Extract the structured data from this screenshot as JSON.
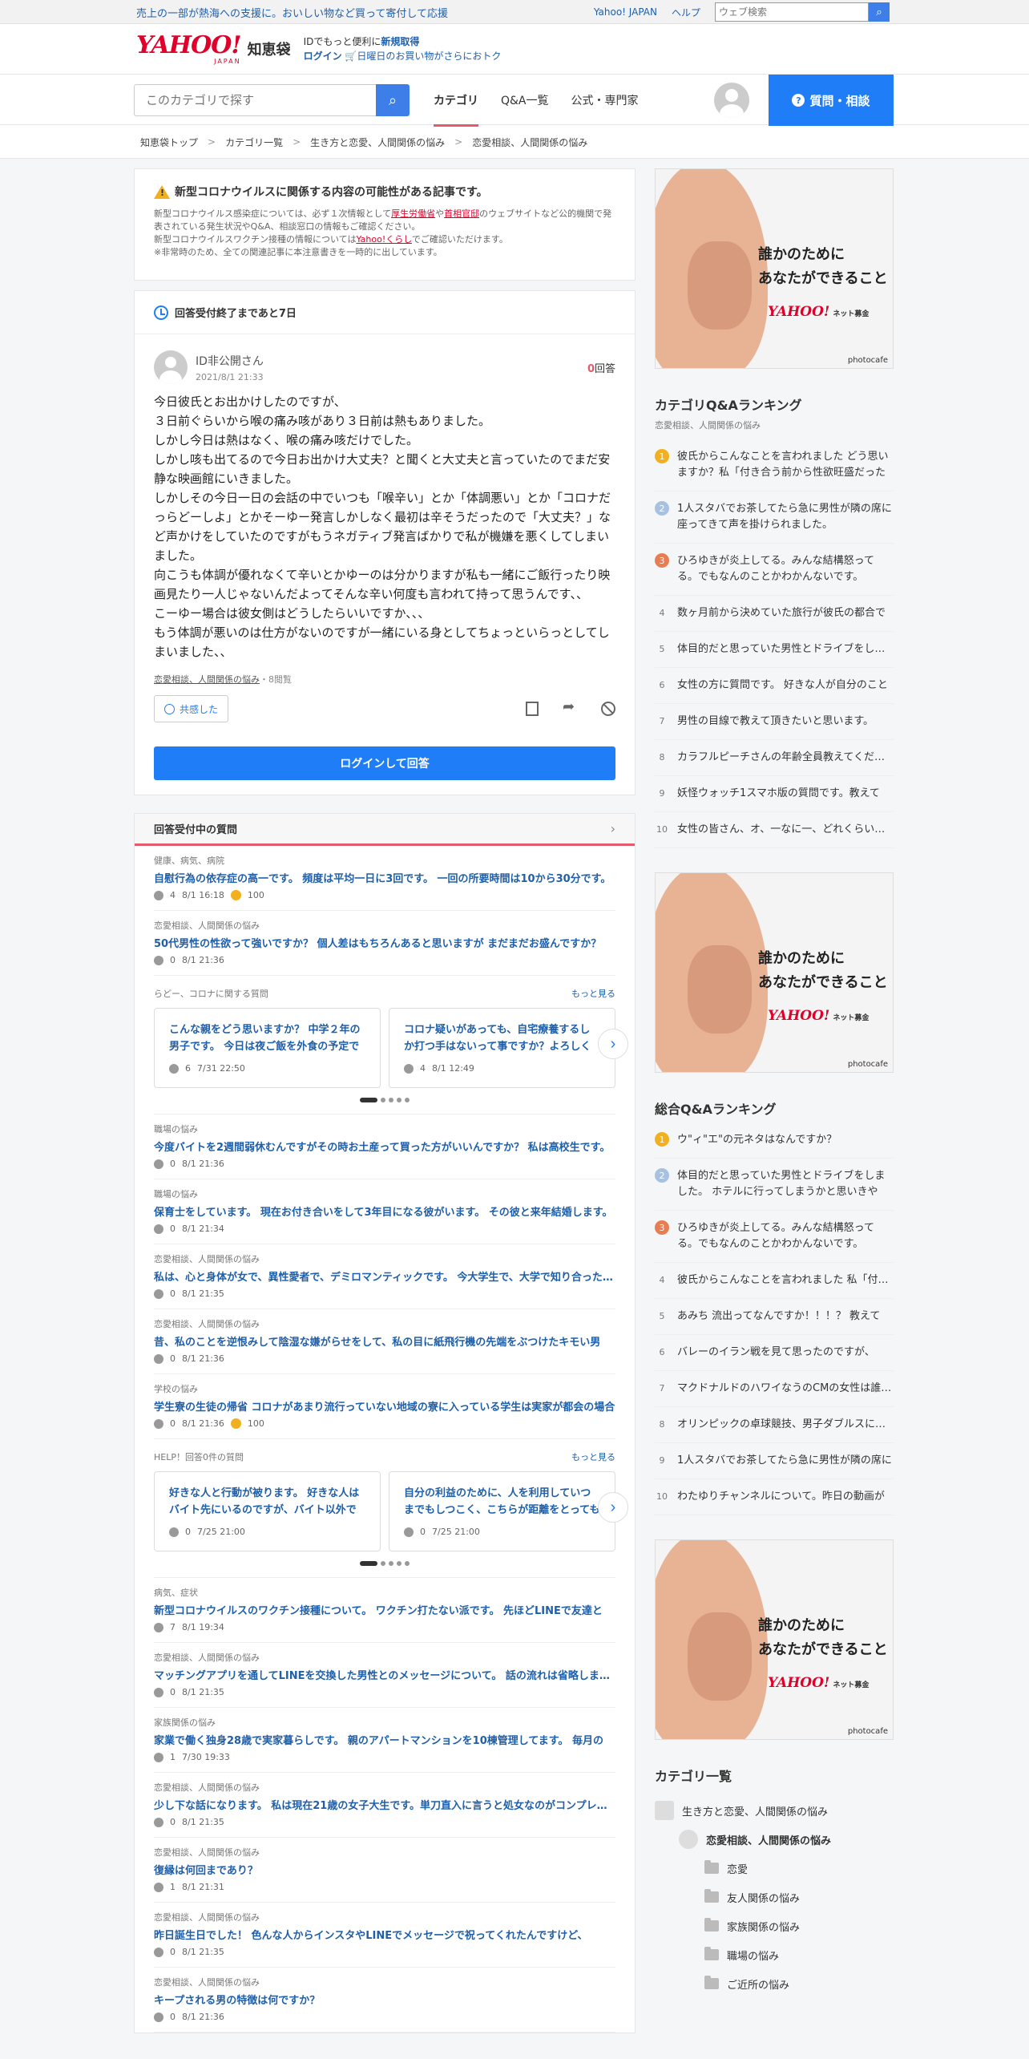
{
  "topbar": {
    "promo": "売上の一部が熱海への支援に。おいしい物など買って寄付して応援",
    "links": [
      "Yahoo! JAPAN",
      "ヘルプ"
    ],
    "search_placeholder": "ウェブ検索"
  },
  "logo": {
    "yahoo": "YAHOO!",
    "japan": "JAPAN",
    "chie": "知恵袋",
    "line1_a": "IDでもっと便利に",
    "line1_b": "新規取得",
    "line2_a": "ログイン",
    "line2_b": "日曜日のお買い物がさらにおトク"
  },
  "nav": {
    "search_placeholder": "このカテゴリで探す",
    "tabs": [
      "カテゴリ",
      "Q&A一覧",
      "公式・専門家"
    ],
    "ask": "質問・相談"
  },
  "breadcrumb": [
    "知恵袋トップ",
    "カテゴリ一覧",
    "生き方と恋愛、人間関係の悩み",
    "恋愛相談、人間関係の悩み"
  ],
  "notice": {
    "title": "新型コロナウイルスに関係する内容の可能性がある記事です。",
    "p1_a": "新型コロナウイルス感染症については、必ず１次情報として",
    "p1_link1": "厚生労働省",
    "p1_mid": "や",
    "p1_link2": "首相官邸",
    "p1_b": "のウェブサイトなど公的機関で発表されている発生状況やQ&A、相談窓口の情報もご確認ください。",
    "p2_a": "新型コロナウイルスワクチン接種の情報については",
    "p2_link": "Yahoo!くらし",
    "p2_b": "でご確認いただけます。",
    "p3": "※非常時のため、全ての関連記事に本注意書きを一時的に出しています。"
  },
  "question": {
    "deadline": "回答受付終了まであと7日",
    "asker": "ID非公開",
    "asker_suffix": "さん",
    "date": "2021/8/1 21:33",
    "answer_count": "0",
    "answer_label": "回答",
    "body": "今日彼氏とお出かけしたのですが、\n３日前ぐらいから喉の痛み咳があり３日前は熱もありました。\nしかし今日は熱はなく、喉の痛み咳だけでした。\nしかし咳も出てるので今日お出かけ大丈夫？と聞くと大丈夫と言っていたのでまだ安静な映画館にいきました。\nしかしその今日一日の会話の中でいつも「喉辛い」とか「体調悪い」とか「コロナだっらどーしよ」とかそーゆー発言しかしなく最初は辛そうだったので「大丈夫？」など声かけをしていたのですがもうネガティブ発言ばかりで私が機嫌を悪くしてしまいました。\n向こうも体調が優れなくて辛いとかゆーのは分かりますが私も一緒にご飯行ったり映画見たり一人じゃないんだよってそんな辛い何度も言われて持って思うんです、、\nこーゆー場合は彼女側はどうしたらいいですか、、、\nもう体調が悪いのは仕方がないのですが一緒にいる身としてちょっといらっとしてしまいました、、",
    "category": "恋愛相談、人間関係の悩み",
    "views": "・8閲覧",
    "empathy": "共感した",
    "login_answer": "ログインして回答"
  },
  "open_questions": {
    "title": "回答受付中の質問",
    "items_a": [
      {
        "cat": "健康、病気、病院",
        "title": "自慰行為の依存症の高一です。 頻度は平均一日に3回です。 一回の所要時間は10から30分です。",
        "count": "4",
        "date": "8/1 16:18",
        "coin": "100"
      },
      {
        "cat": "恋愛相談、人間関係の悩み",
        "title": "50代男性の性欲って強いですか？ 個人差はもちろんあると思いますが まだまだお盛んですか？",
        "count": "0",
        "date": "8/1 21:36",
        "coin": ""
      }
    ],
    "carousel1": {
      "head": "らどー、コロナに関する質問",
      "more": "もっと見る",
      "cards": [
        {
          "title": "こんな親をどう思いますか？ 中学２年の男子です。 今日は夜ご飯を外食の予定でした。",
          "count": "6",
          "date": "7/31 22:50"
        },
        {
          "title": "コロナ疑いがあっても、自宅療養するしか打つ手はないって事ですか？よろしくお願いします",
          "count": "4",
          "date": "8/1 12:49"
        }
      ]
    },
    "items_b": [
      {
        "cat": "職場の悩み",
        "title": "今度バイトを2週間弱休むんですがその時お土産って買った方がいいんですか？ 私は高校生です。",
        "count": "0",
        "date": "8/1 21:36",
        "coin": ""
      },
      {
        "cat": "職場の悩み",
        "title": "保育士をしています。 現在お付き合いをして3年目になる彼がいます。 その彼と来年結婚します。",
        "count": "0",
        "date": "8/1 21:34",
        "coin": ""
      },
      {
        "cat": "恋愛相談、人間関係の悩み",
        "title": "私は、心と身体が女で、異性愛者で、デミロマンティックです。 今大学生で、大学で知り合った人が",
        "count": "0",
        "date": "8/1 21:35",
        "coin": ""
      },
      {
        "cat": "恋愛相談、人間関係の悩み",
        "title": "昔、私のことを逆恨みして陰湿な嫌がらせをして、私の目に紙飛行機の先端をぶつけたキモい男",
        "count": "0",
        "date": "8/1 21:36",
        "coin": ""
      },
      {
        "cat": "学校の悩み",
        "title": "学生寮の生徒の帰省 コロナがあまり流行っていない地域の寮に入っている学生は実家が都会の場合",
        "count": "0",
        "date": "8/1 21:36",
        "coin": "100"
      }
    ],
    "carousel2": {
      "head": "HELP！回答0件の質問",
      "more": "もっと見る",
      "cards": [
        {
          "title": "好きな人と行動が被ります。 好きな人はバイト先にいるのですが、バイト以外でも会います。",
          "count": "0",
          "date": "7/25 21:00"
        },
        {
          "title": "自分の利益のために、人を利用していつまでもしつこく、こちらが距離をとっても関わってきます",
          "count": "0",
          "date": "7/25 21:00"
        }
      ]
    },
    "items_c": [
      {
        "cat": "病気、症状",
        "title": "新型コロナウイルスのワクチン接種について。 ワクチン打たない派です。 先ほどLINEで友達と",
        "count": "7",
        "date": "8/1 19:34",
        "coin": ""
      },
      {
        "cat": "恋愛相談、人間関係の悩み",
        "title": "マッチングアプリを通してLINEを交換した男性とのメッセージについて。 話の流れは省略します。",
        "count": "0",
        "date": "8/1 21:35",
        "coin": ""
      },
      {
        "cat": "家族関係の悩み",
        "title": "家業で働く独身28歳で実家暮らしです。 親のアパートマンションを10棟管理してます。 毎月の",
        "count": "1",
        "date": "7/30 19:33",
        "coin": ""
      },
      {
        "cat": "恋愛相談、人間関係の悩み",
        "title": "少し下な話になります。 私は現在21歳の女子大生です。単刀直入に言うと処女なのがコンプレックス",
        "count": "0",
        "date": "8/1 21:35",
        "coin": ""
      },
      {
        "cat": "恋愛相談、人間関係の悩み",
        "title": "復縁は何回まであり？",
        "count": "1",
        "date": "8/1 21:31",
        "coin": ""
      },
      {
        "cat": "恋愛相談、人間関係の悩み",
        "title": "昨日誕生日でした！ 色んな人からインスタやLINEでメッセージで祝ってくれたんですけど、",
        "count": "0",
        "date": "8/1 21:35",
        "coin": ""
      },
      {
        "cat": "恋愛相談、人間関係の悩み",
        "title": "キープされる男の特徴は何ですか？",
        "count": "0",
        "date": "8/1 21:36",
        "coin": ""
      }
    ]
  },
  "ad": {
    "copy1": "誰かのために",
    "copy2": "あなたができること",
    "brand": "YAHOO!",
    "brand_sub": "ネット募金",
    "credit": "photocafe"
  },
  "category_ranking": {
    "title": "カテゴリQ&Aランキング",
    "sub": "恋愛相談、人間関係の悩み",
    "items": [
      "彼氏からこんなことを言われました どう思いますか？私「付き合う前から性欲旺盛だったけど」",
      "1人スタバでお茶してたら急に男性が隣の席に座ってきて声を掛けられました。",
      "ひろゆきが炎上してる。みんな結構怒ってる。でもなんのことかわかんないです。",
      "数ヶ月前から決めていた旅行が彼氏の都合で",
      "体目的だと思っていた男性とドライブをしました",
      "女性の方に質問です。 好きな人が自分のこと",
      "男性の目線で教えて頂きたいと思います。",
      "カラフルピーチさんの年齢全員教えてください",
      "妖怪ウォッチ1スマホ版の質問です。教えて",
      "女性の皆さん、オ、一なに一、どれくらいの頻度"
    ]
  },
  "total_ranking": {
    "title": "総合Q&Aランキング",
    "items": [
      "ウ\"ィ\"エ\"の元ネタはなんですか？",
      "体目的だと思っていた男性とドライブをしました。 ホテルに行ってしまうかと思いきや",
      "ひろゆきが炎上してる。みんな結構怒ってる。でもなんのことかわかんないです。",
      "彼氏からこんなことを言われました 私「付き合う",
      "あみち 流出ってなんですか！！！？ 教えて",
      "バレーのイラン戦を見て思ったのですが、",
      "マクドナルドのハワイなうのCMの女性は誰ですか",
      "オリンピックの卓球競技、男子ダブルスについて",
      "1人スタバでお茶してたら急に男性が隣の席に",
      "わたゆりチャンネルについて。昨日の動画が"
    ]
  },
  "category_list": {
    "title": "カテゴリ一覧",
    "parent": "生き方と恋愛、人間関係の悩み",
    "current": "恋愛相談、人間関係の悩み",
    "children": [
      "恋愛",
      "友人関係の悩み",
      "家族関係の悩み",
      "職場の悩み",
      "ご近所の悩み"
    ]
  }
}
